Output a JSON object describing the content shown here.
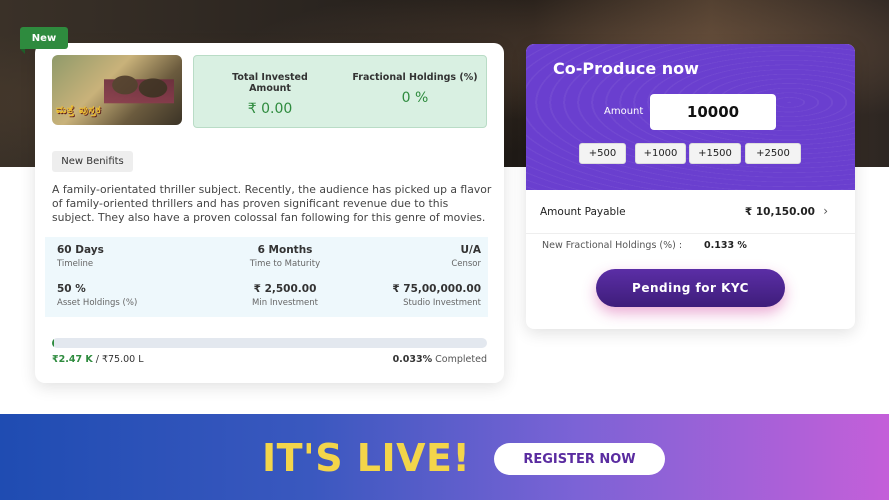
{
  "project": {
    "new_tag": "New",
    "poster_title_art": "ಮತ್ತೆ ಪುಸ್ತಕ",
    "total_invested_label": "Total Invested Amount",
    "total_invested_value": "₹ 0.00",
    "fractional_holdings_label": "Fractional Holdings (%)",
    "fractional_holdings_value": "0 %",
    "benefits_chip": "New Benifits",
    "description": "A family-orientated thriller subject. Recently, the audience has picked up a flavor of family-oriented thrillers and has proven significant revenue due to this subject. They also have a proven colossal fan following for this genre of movies.",
    "info": {
      "timeline_value": "60 Days",
      "timeline_label": "Timeline",
      "maturity_value": "6 Months",
      "maturity_label": "Time to Maturity",
      "censor_value": "U/A",
      "censor_label": "Censor",
      "asset_value": "50 %",
      "asset_label": "Asset Holdings (%)",
      "min_value": "₹ 2,500.00",
      "min_label": "Min Investment",
      "studio_value": "₹ 75,00,000.00",
      "studio_label": "Studio Investment"
    },
    "progress_fraction": 0.00033,
    "raised_value": "₹2.47 K",
    "raised_total": "/ ₹75.00 L",
    "completed_pct": "0.033%",
    "completed_label": "Completed"
  },
  "coproduce": {
    "title": "Co-Produce now",
    "amount_label": "Amount",
    "amount_value": "10000",
    "increments": [
      "+500",
      "+1000",
      "+1500",
      "+2500"
    ],
    "amount_payable_label": "Amount Payable",
    "amount_payable_value": "₹ 10,150.00",
    "new_holdings_label": "New Fractional Holdings (%) :",
    "new_holdings_value": "0.133 %",
    "kyc_button": "Pending for KYC"
  },
  "banner": {
    "live_text": "IT'S LIVE!",
    "register_button": "REGISTER NOW"
  },
  "colors": {
    "accent_green": "#2e8b3e",
    "purple": "#6a3fcf",
    "live_yellow": "#f3d54a"
  }
}
